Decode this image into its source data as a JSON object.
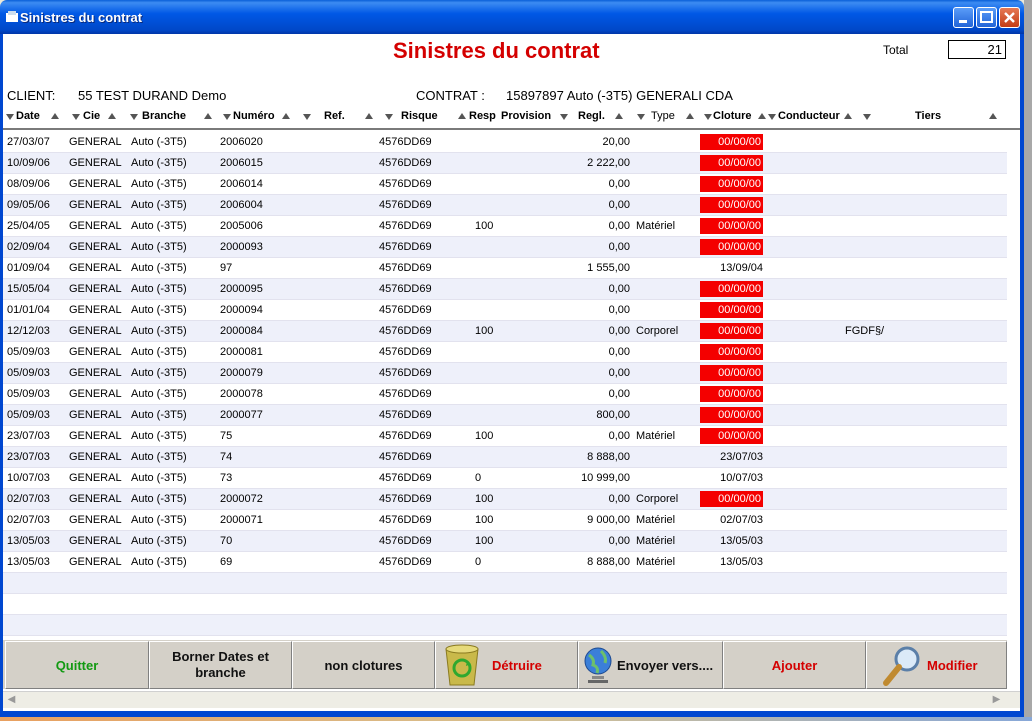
{
  "window": {
    "title": "Sinistres du contrat"
  },
  "header": {
    "heading": "Sinistres du contrat",
    "total_label": "Total",
    "total_value": "21",
    "client_label": "CLIENT:",
    "client_value": "55 TEST DURAND Demo",
    "contrat_label": "CONTRAT :",
    "contrat_value": "15897897 Auto (-3T5) GENERALI CDA"
  },
  "columns": [
    "Date",
    "Cie",
    "Branche",
    "Numéro",
    "Ref.",
    "Risque",
    "Resp",
    "Provision",
    "Regl.",
    "Type",
    "Cloture",
    "Conducteur",
    "Tiers"
  ],
  "rows": [
    {
      "date": "27/03/07",
      "cie": "GENERAL",
      "branche": "Auto (-3T5)",
      "numero": "2006020",
      "risque": "4576DD69",
      "resp": "",
      "regl": "20,00",
      "type": "",
      "cloture": "00/00/00",
      "tiers": ""
    },
    {
      "date": "10/09/06",
      "cie": "GENERAL",
      "branche": "Auto (-3T5)",
      "numero": "2006015",
      "risque": "4576DD69",
      "resp": "",
      "regl": "2 222,00",
      "type": "",
      "cloture": "00/00/00",
      "tiers": ""
    },
    {
      "date": "08/09/06",
      "cie": "GENERAL",
      "branche": "Auto (-3T5)",
      "numero": "2006014",
      "risque": "4576DD69",
      "resp": "",
      "regl": "0,00",
      "type": "",
      "cloture": "00/00/00",
      "tiers": ""
    },
    {
      "date": "09/05/06",
      "cie": "GENERAL",
      "branche": "Auto (-3T5)",
      "numero": "2006004",
      "risque": "4576DD69",
      "resp": "",
      "regl": "0,00",
      "type": "",
      "cloture": "00/00/00",
      "tiers": ""
    },
    {
      "date": "25/04/05",
      "cie": "GENERAL",
      "branche": "Auto (-3T5)",
      "numero": "2005006",
      "risque": "4576DD69",
      "resp": "100",
      "regl": "0,00",
      "type": "Matériel",
      "cloture": "00/00/00",
      "tiers": ""
    },
    {
      "date": "02/09/04",
      "cie": "GENERAL",
      "branche": "Auto (-3T5)",
      "numero": "2000093",
      "risque": "4576DD69",
      "resp": "",
      "regl": "0,00",
      "type": "",
      "cloture": "00/00/00",
      "tiers": ""
    },
    {
      "date": "01/09/04",
      "cie": "GENERAL",
      "branche": "Auto (-3T5)",
      "numero": "97",
      "risque": "4576DD69",
      "resp": "",
      "regl": "1 555,00",
      "type": "",
      "cloture": "13/09/04",
      "tiers": ""
    },
    {
      "date": "15/05/04",
      "cie": "GENERAL",
      "branche": "Auto (-3T5)",
      "numero": "2000095",
      "risque": "4576DD69",
      "resp": "",
      "regl": "0,00",
      "type": "",
      "cloture": "00/00/00",
      "tiers": ""
    },
    {
      "date": "01/01/04",
      "cie": "GENERAL",
      "branche": "Auto (-3T5)",
      "numero": "2000094",
      "risque": "4576DD69",
      "resp": "",
      "regl": "0,00",
      "type": "",
      "cloture": "00/00/00",
      "tiers": ""
    },
    {
      "date": "12/12/03",
      "cie": "GENERAL",
      "branche": "Auto (-3T5)",
      "numero": "2000084",
      "risque": "4576DD69",
      "resp": "100",
      "regl": "0,00",
      "type": "Corporel",
      "cloture": "00/00/00",
      "tiers": "FGDF§/"
    },
    {
      "date": "05/09/03",
      "cie": "GENERAL",
      "branche": "Auto (-3T5)",
      "numero": "2000081",
      "risque": "4576DD69",
      "resp": "",
      "regl": "0,00",
      "type": "",
      "cloture": "00/00/00",
      "tiers": ""
    },
    {
      "date": "05/09/03",
      "cie": "GENERAL",
      "branche": "Auto (-3T5)",
      "numero": "2000079",
      "risque": "4576DD69",
      "resp": "",
      "regl": "0,00",
      "type": "",
      "cloture": "00/00/00",
      "tiers": ""
    },
    {
      "date": "05/09/03",
      "cie": "GENERAL",
      "branche": "Auto (-3T5)",
      "numero": "2000078",
      "risque": "4576DD69",
      "resp": "",
      "regl": "0,00",
      "type": "",
      "cloture": "00/00/00",
      "tiers": ""
    },
    {
      "date": "05/09/03",
      "cie": "GENERAL",
      "branche": "Auto (-3T5)",
      "numero": "2000077",
      "risque": "4576DD69",
      "resp": "",
      "regl": "800,00",
      "type": "",
      "cloture": "00/00/00",
      "tiers": ""
    },
    {
      "date": "23/07/03",
      "cie": "GENERAL",
      "branche": "Auto (-3T5)",
      "numero": "75",
      "risque": "4576DD69",
      "resp": "100",
      "regl": "0,00",
      "type": "Matériel",
      "cloture": "00/00/00",
      "tiers": ""
    },
    {
      "date": "23/07/03",
      "cie": "GENERAL",
      "branche": "Auto (-3T5)",
      "numero": "74",
      "risque": "4576DD69",
      "resp": "",
      "regl": "8 888,00",
      "type": "",
      "cloture": "23/07/03",
      "tiers": ""
    },
    {
      "date": "10/07/03",
      "cie": "GENERAL",
      "branche": "Auto (-3T5)",
      "numero": "73",
      "risque": "4576DD69",
      "resp": "0",
      "regl": "10 999,00",
      "type": "",
      "cloture": "10/07/03",
      "tiers": ""
    },
    {
      "date": "02/07/03",
      "cie": "GENERAL",
      "branche": "Auto (-3T5)",
      "numero": "2000072",
      "risque": "4576DD69",
      "resp": "100",
      "regl": "0,00",
      "type": "Corporel",
      "cloture": "00/00/00",
      "tiers": ""
    },
    {
      "date": "02/07/03",
      "cie": "GENERAL",
      "branche": "Auto (-3T5)",
      "numero": "2000071",
      "risque": "4576DD69",
      "resp": "100",
      "regl": "9 000,00",
      "type": "Matériel",
      "cloture": "02/07/03",
      "tiers": ""
    },
    {
      "date": "13/05/03",
      "cie": "GENERAL",
      "branche": "Auto (-3T5)",
      "numero": "70",
      "risque": "4576DD69",
      "resp": "100",
      "regl": "0,00",
      "type": "Matériel",
      "cloture": "13/05/03",
      "tiers": ""
    },
    {
      "date": "13/05/03",
      "cie": "GENERAL",
      "branche": "Auto (-3T5)",
      "numero": "69",
      "risque": "4576DD69",
      "resp": "0",
      "regl": "8 888,00",
      "type": "Matériel",
      "cloture": "13/05/03",
      "tiers": ""
    }
  ],
  "buttons": {
    "quitter": "Quitter",
    "borner": "Borner Dates et branche",
    "non_clotures": "non clotures",
    "detruire": "Détruire",
    "envoyer": "Envoyer vers....",
    "ajouter": "Ajouter",
    "modifier": "Modifier"
  },
  "icons": {
    "detruire": "recycle-bin-icon",
    "envoyer": "globe-icon",
    "modifier": "magnifier-icon"
  },
  "colors": {
    "open_claim_bg": "#f40000",
    "heading": "#d40000",
    "button_green": "#129a12",
    "button_red": "#d40000"
  }
}
